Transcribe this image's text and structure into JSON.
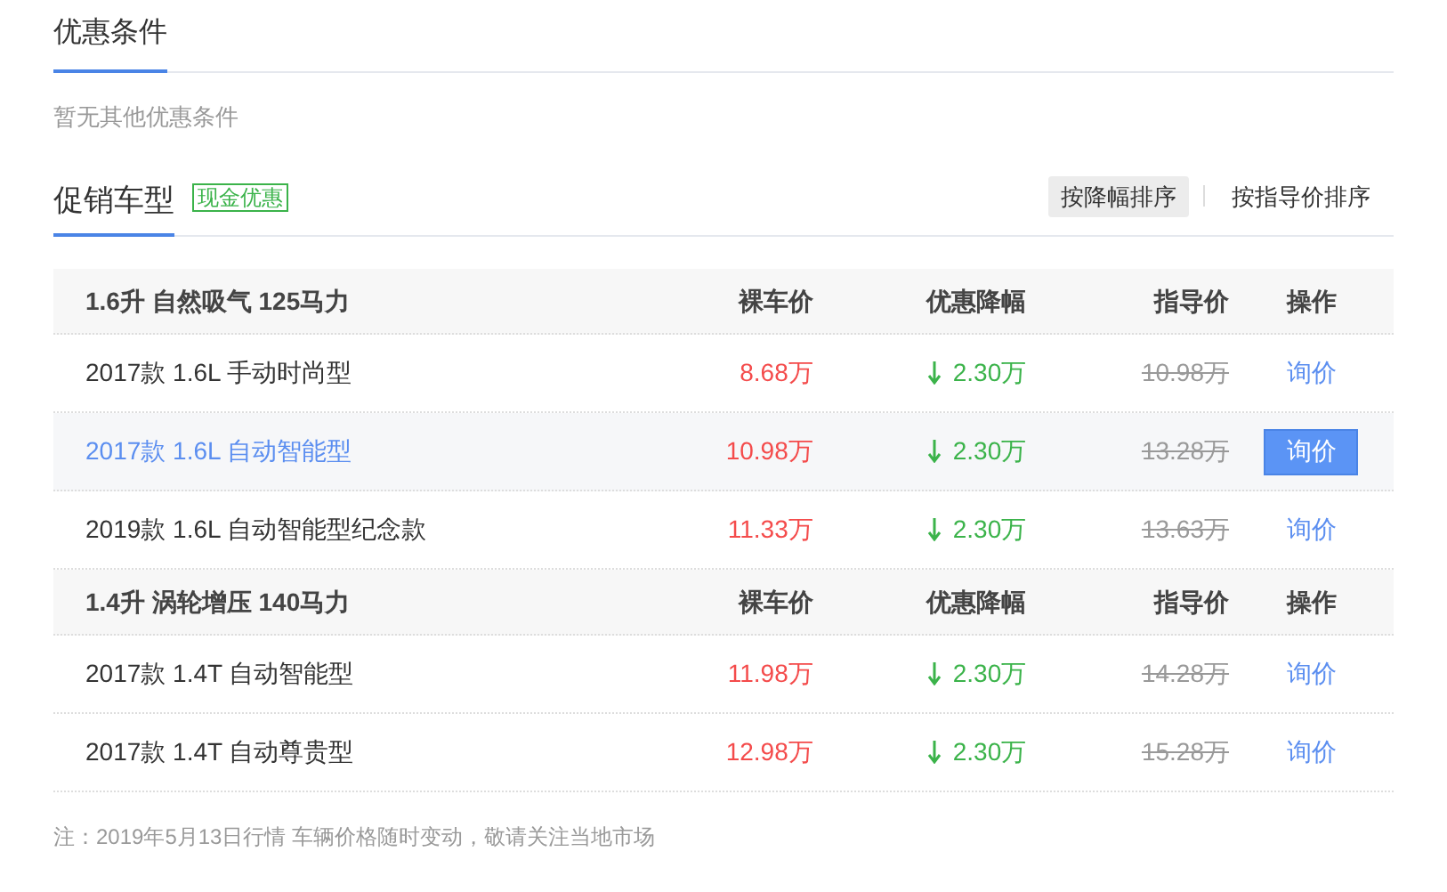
{
  "conditions": {
    "title": "优惠条件",
    "empty_text": "暂无其他优惠条件"
  },
  "promo": {
    "title": "促销车型",
    "tag": "现金优惠",
    "sort_buttons": [
      {
        "label": "按降幅排序",
        "selected": true
      },
      {
        "label": "按指导价排序",
        "selected": false
      }
    ]
  },
  "groups": [
    {
      "name": "1.6升 自然吸气 125马力",
      "columns": [
        "裸车价",
        "优惠降幅",
        "指导价",
        "操作"
      ],
      "rows": [
        {
          "name": "2017款 1.6L 手动时尚型",
          "price": "8.68万",
          "discount": "2.30万",
          "guide_price": "10.98万",
          "action": "询价",
          "selected": false
        },
        {
          "name": "2017款 1.6L 自动智能型",
          "price": "10.98万",
          "discount": "2.30万",
          "guide_price": "13.28万",
          "action": "询价",
          "selected": true
        },
        {
          "name": "2019款 1.6L 自动智能型纪念款",
          "price": "11.33万",
          "discount": "2.30万",
          "guide_price": "13.63万",
          "action": "询价",
          "selected": false
        }
      ]
    },
    {
      "name": "1.4升 涡轮增压 140马力",
      "columns": [
        "裸车价",
        "优惠降幅",
        "指导价",
        "操作"
      ],
      "rows": [
        {
          "name": "2017款 1.4T 自动智能型",
          "price": "11.98万",
          "discount": "2.30万",
          "guide_price": "14.28万",
          "action": "询价",
          "selected": false
        },
        {
          "name": "2017款 1.4T 自动尊贵型",
          "price": "12.98万",
          "discount": "2.30万",
          "guide_price": "15.28万",
          "action": "询价",
          "selected": false
        }
      ]
    }
  ],
  "note": "注：2019年5月13日行情 车辆价格随时变动，敬请关注当地市场"
}
